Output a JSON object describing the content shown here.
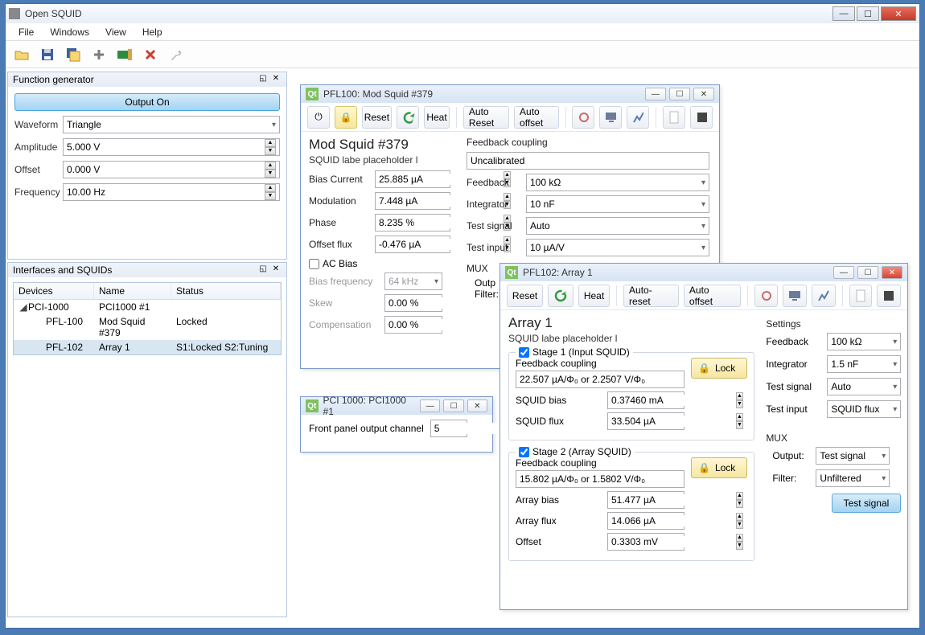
{
  "app": {
    "title": "Open SQUID"
  },
  "menu": [
    "File",
    "Windows",
    "View",
    "Help"
  ],
  "func_gen": {
    "title": "Function generator",
    "output_btn": "Output On",
    "waveform_label": "Waveform",
    "waveform_value": "Triangle",
    "amplitude_label": "Amplitude",
    "amplitude_value": "5.000 V",
    "offset_label": "Offset",
    "offset_value": "0.000 V",
    "freq_label": "Frequency",
    "freq_value": "10.00 Hz"
  },
  "ifc": {
    "title": "Interfaces and SQUIDs",
    "hdr_devices": "Devices",
    "hdr_name": "Name",
    "hdr_status": "Status",
    "rows": [
      {
        "dev": "PCI-1000",
        "name": "PCI1000 #1",
        "status": ""
      },
      {
        "dev": "PFL-100",
        "name": "Mod Squid #379",
        "status": "Locked"
      },
      {
        "dev": "PFL-102",
        "name": "Array 1",
        "status": "S1:Locked  S2:Tuning"
      }
    ]
  },
  "pfl100": {
    "title": "PFL100: Mod Squid #379",
    "tb": {
      "reset": "Reset",
      "heat": "Heat",
      "auto_reset": "Auto Reset",
      "auto_offset": "Auto offset"
    },
    "name": "Mod Squid #379",
    "subtitle": "SQUID labe placeholder l",
    "bias_current_label": "Bias Current",
    "bias_current_value": "25.885 µA",
    "modulation_label": "Modulation",
    "modulation_value": "7.448 µA",
    "phase_label": "Phase",
    "phase_value": "8.235 %",
    "offset_flux_label": "Offset flux",
    "offset_flux_value": "-0.476 µA",
    "ac_bias_label": "AC Bias",
    "bias_freq_label": "Bias frequency",
    "bias_freq_value": "64 kHz",
    "skew_label": "Skew",
    "skew_value": "0.00 %",
    "comp_label": "Compensation",
    "comp_value": "0.00 %",
    "fb_coupling_label": "Feedback coupling",
    "fb_coupling_value": "Uncalibrated",
    "feedback_label": "Feedback",
    "feedback_value": "100 kΩ",
    "integrator_label": "Integrator",
    "integrator_value": "10 nF",
    "test_signal_label": "Test signal",
    "test_signal_value": "Auto",
    "test_input_label": "Test input",
    "test_input_value": "10 µA/V",
    "mux_label": "MUX",
    "output_label": "Outp",
    "filter_label": "Filter:"
  },
  "pci1000": {
    "title": "PCI 1000: PCI1000 #1",
    "front_label": "Front panel output channel",
    "front_value": "5"
  },
  "pfl102": {
    "title": "PFL102: Array 1",
    "tb": {
      "reset": "Reset",
      "heat": "Heat",
      "auto_reset": "Auto-reset",
      "auto_offset": "Auto offset"
    },
    "name": "Array 1",
    "subtitle": "SQUID labe placeholder l",
    "stage1_label": "Stage 1 (Input SQUID)",
    "fb1_label": "Feedback coupling",
    "fb1_value": "22.507 µA/Φ₀ or 2.2507 V/Φ₀",
    "sq_bias_label": "SQUID bias",
    "sq_bias_value": "0.37460 mA",
    "sq_flux_label": "SQUID flux",
    "sq_flux_value": "33.504 µA",
    "lock_label": "Lock",
    "stage2_label": "Stage 2 (Array SQUID)",
    "fb2_label": "Feedback coupling",
    "fb2_value": "15.802 µA/Φ₀ or 1.5802 V/Φ₀",
    "arr_bias_label": "Array bias",
    "arr_bias_value": "51.477 µA",
    "arr_flux_label": "Array flux",
    "arr_flux_value": "14.066 µA",
    "off_label": "Offset",
    "off_value": "0.3303 mV",
    "settings_label": "Settings",
    "feedback_label": "Feedback",
    "feedback_value": "100 kΩ",
    "integrator_label": "Integrator",
    "integrator_value": "1.5 nF",
    "test_signal_label": "Test signal",
    "test_signal_value": "Auto",
    "test_input_label": "Test input",
    "test_input_value": "SQUID flux",
    "mux_label": "MUX",
    "mux_output_label": "Output:",
    "mux_output_value": "Test signal",
    "mux_filter_label": "Filter:",
    "mux_filter_value": "Unfiltered",
    "test_btn": "Test signal"
  }
}
